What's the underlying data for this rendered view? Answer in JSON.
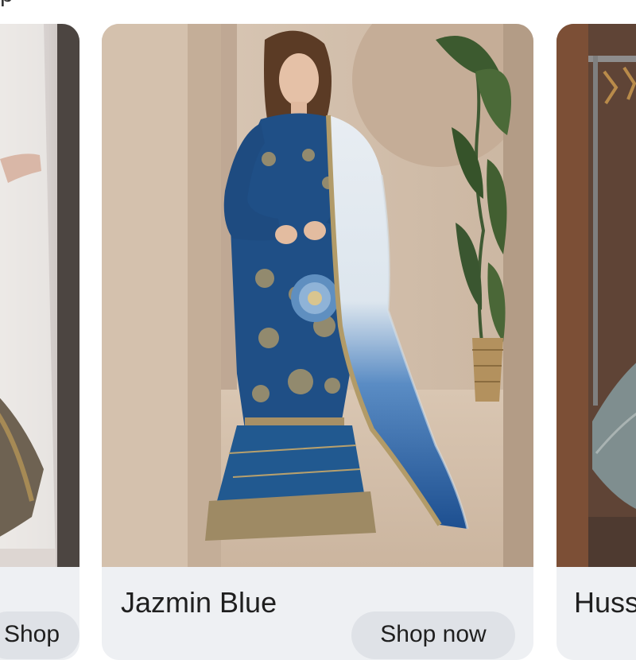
{
  "header": {
    "text": "p"
  },
  "cards": [
    {
      "title": "",
      "button": "Shop now"
    },
    {
      "title": "Jazmin Blue",
      "button": "Shop now"
    },
    {
      "title": "Huss",
      "button": ""
    }
  ],
  "colors": {
    "card_bg": "#eef0f3",
    "button_bg": "#dfe2e7",
    "dress_blue": "#1f4f86",
    "dupatta_blue": "#2c5c99"
  }
}
